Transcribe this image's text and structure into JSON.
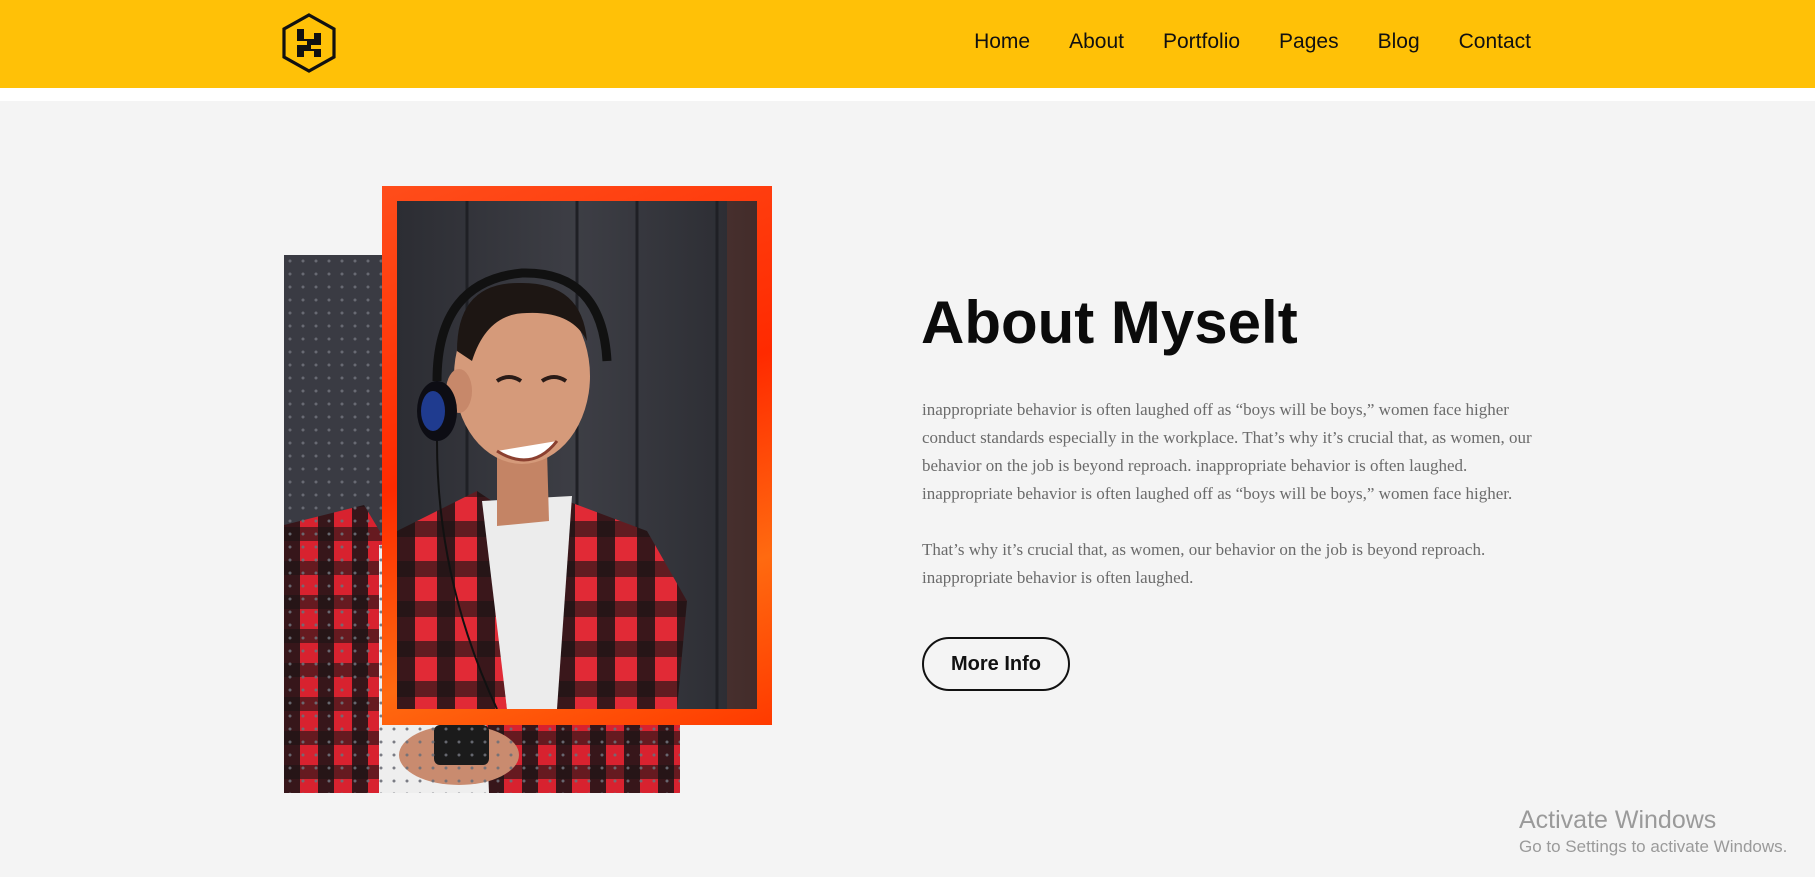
{
  "nav": {
    "items": [
      {
        "label": "Home"
      },
      {
        "label": "About"
      },
      {
        "label": "Portfolio"
      },
      {
        "label": "Pages"
      },
      {
        "label": "Blog"
      },
      {
        "label": "Contact"
      }
    ]
  },
  "logo": {
    "icon": "hexagon-s-logo-icon"
  },
  "about": {
    "title": "About Myselt",
    "paragraph1": "inappropriate behavior is often laughed off as “boys will be boys,” women face higher conduct standards especially in the workplace. That’s why it’s crucial that, as women, our behavior on the job is beyond reproach. inappropriate behavior is often laughed. inappropriate behavior is often laughed off as “boys will be boys,” women face higher.",
    "paragraph2": "That’s why it’s crucial that, as women, our behavior on the job is beyond reproach. inappropriate behavior is often laughed.",
    "button": "More Info"
  },
  "watermark": {
    "title": "Activate Windows",
    "subtitle": "Go to Settings to activate Windows."
  },
  "colors": {
    "header_bg": "#ffc107",
    "page_bg": "#f4f4f4",
    "frame_accent": "#ff3a00"
  }
}
